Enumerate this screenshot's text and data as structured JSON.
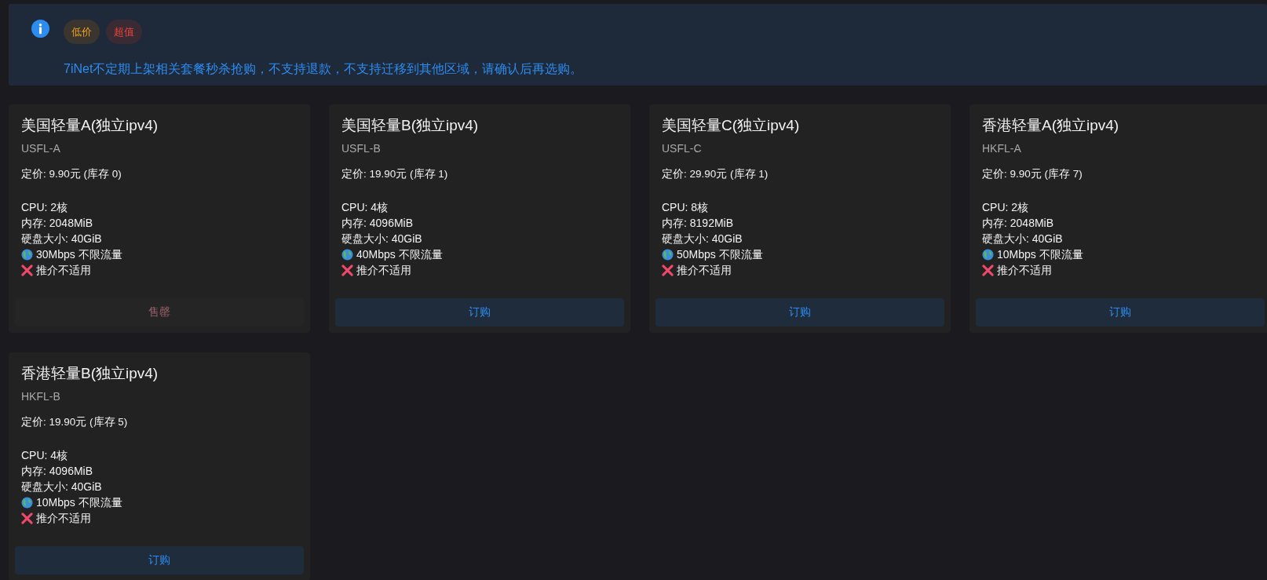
{
  "notice": {
    "tags": [
      {
        "label": "低价",
        "kind": "warning"
      },
      {
        "label": "超值",
        "kind": "danger"
      }
    ],
    "message": "7iNet不定期上架相关套餐秒杀抢购，不支持退款，不支持迁移到其他区域，请确认后再选购。"
  },
  "plans": [
    {
      "name": "美国轻量A(独立ipv4)",
      "code": "USFL-A",
      "price": "定价: 9.90元 (库存 0)",
      "cpu": "CPU: 2核",
      "memory": "内存: 2048MiB",
      "disk": "硬盘大小: 40GiB",
      "bandwidth": "30Mbps 不限流量",
      "referral": "推介不适用",
      "button": {
        "label": "售罄",
        "disabled": true
      }
    },
    {
      "name": "美国轻量B(独立ipv4)",
      "code": "USFL-B",
      "price": "定价: 19.90元 (库存 1)",
      "cpu": "CPU: 4核",
      "memory": "内存: 4096MiB",
      "disk": "硬盘大小: 40GiB",
      "bandwidth": "40Mbps 不限流量",
      "referral": "推介不适用",
      "button": {
        "label": "订购",
        "disabled": false
      }
    },
    {
      "name": "美国轻量C(独立ipv4)",
      "code": "USFL-C",
      "price": "定价: 29.90元 (库存 1)",
      "cpu": "CPU: 8核",
      "memory": "内存: 8192MiB",
      "disk": "硬盘大小: 40GiB",
      "bandwidth": "50Mbps 不限流量",
      "referral": "推介不适用",
      "button": {
        "label": "订购",
        "disabled": false
      }
    },
    {
      "name": "香港轻量A(独立ipv4)",
      "code": "HKFL-A",
      "price": "定价: 9.90元 (库存 7)",
      "cpu": "CPU: 2核",
      "memory": "内存: 2048MiB",
      "disk": "硬盘大小: 40GiB",
      "bandwidth": "10Mbps 不限流量",
      "referral": "推介不适用",
      "button": {
        "label": "订购",
        "disabled": false
      }
    },
    {
      "name": "香港轻量B(独立ipv4)",
      "code": "HKFL-B",
      "price": "定价: 19.90元 (库存 5)",
      "cpu": "CPU: 4核",
      "memory": "内存: 4096MiB",
      "disk": "硬盘大小: 40GiB",
      "bandwidth": "10Mbps 不限流量",
      "referral": "推介不适用",
      "button": {
        "label": "订购",
        "disabled": false
      }
    }
  ]
}
